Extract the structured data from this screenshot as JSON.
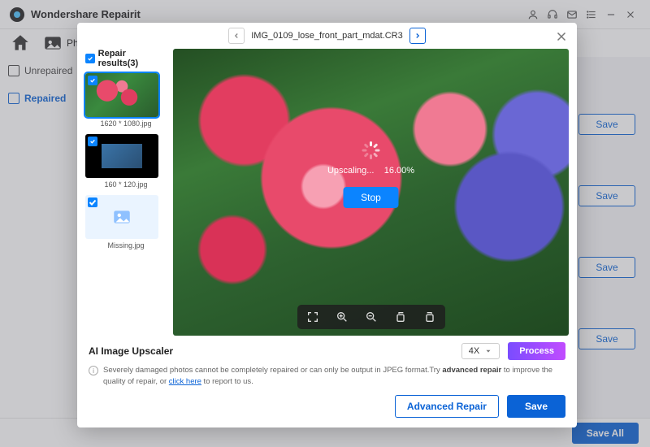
{
  "app": {
    "title": "Wondershare Repairit"
  },
  "toolbar": {
    "photo": "Photo"
  },
  "sidebar": {
    "items": [
      {
        "label": "Unrepaired"
      },
      {
        "label": "Repaired"
      }
    ]
  },
  "right_saves": [
    "Save",
    "Save",
    "Save",
    "Save"
  ],
  "bottom": {
    "save_all": "Save All"
  },
  "modal": {
    "filename": "IMG_0109_lose_front_part_mdat.CR3",
    "results_heading": "Repair results(3)",
    "thumbs": [
      {
        "caption": "1620 * 1080.jpg",
        "kind": "flowers",
        "selected": true
      },
      {
        "caption": "160 * 120.jpg",
        "kind": "dark",
        "selected": false
      },
      {
        "caption": "Missing.jpg",
        "kind": "missing",
        "selected": false
      }
    ],
    "progress": {
      "label": "Upscaling...",
      "percent": "16.00%"
    },
    "stop": "Stop",
    "upscaler": {
      "label": "AI Image Upscaler",
      "scale": "4X",
      "process": "Process"
    },
    "note": {
      "pre": "Severely damaged photos cannot be completely repaired or can only be output in JPEG format.Try ",
      "bold": "advanced repair",
      "mid": " to improve the quality of repair, or ",
      "link": "click here",
      "post": " to report to us."
    },
    "footer": {
      "advanced": "Advanced Repair",
      "save": "Save"
    }
  }
}
